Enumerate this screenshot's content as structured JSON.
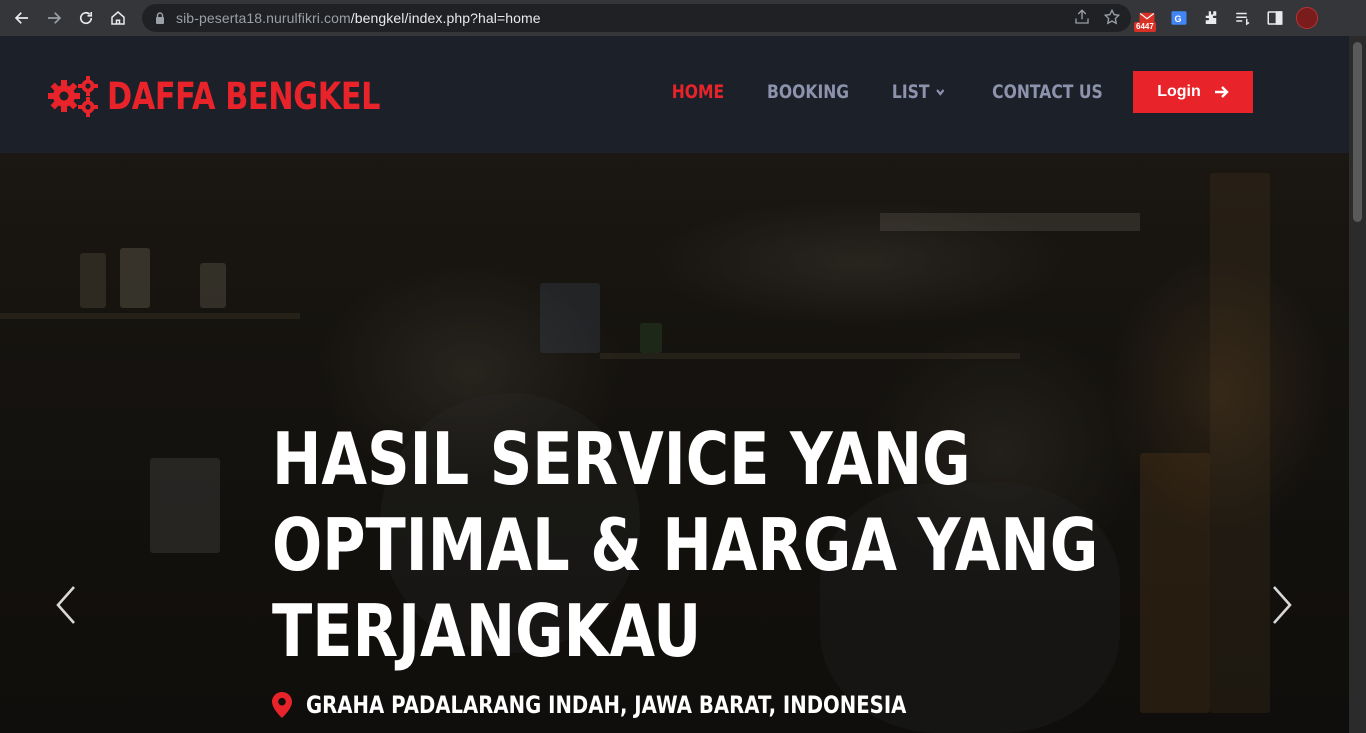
{
  "browser": {
    "url_host": "sib-peserta18.nurulfikri.com",
    "url_path": "/bengkel/index.php?hal=home",
    "mail_badge": "6447"
  },
  "navbar": {
    "brand": "DAFFA BENGKEL",
    "menu": [
      {
        "label": "HOME",
        "active": true
      },
      {
        "label": "BOOKING",
        "active": false
      },
      {
        "label": "LIST",
        "active": false,
        "dropdown": true
      },
      {
        "label": "CONTACT US",
        "active": false
      }
    ],
    "login_label": "Login"
  },
  "hero": {
    "headline_lines": [
      "HASIL SERVICE YANG",
      "OPTIMAL & HARGA YANG",
      "TERJANGKAU"
    ],
    "location": "GRAHA PADALARANG INDAH, JAWA BARAT, INDONESIA"
  },
  "colors": {
    "accent": "#e8232a",
    "nav_bg": "#1c2029",
    "nav_text": "#8d93ad"
  }
}
